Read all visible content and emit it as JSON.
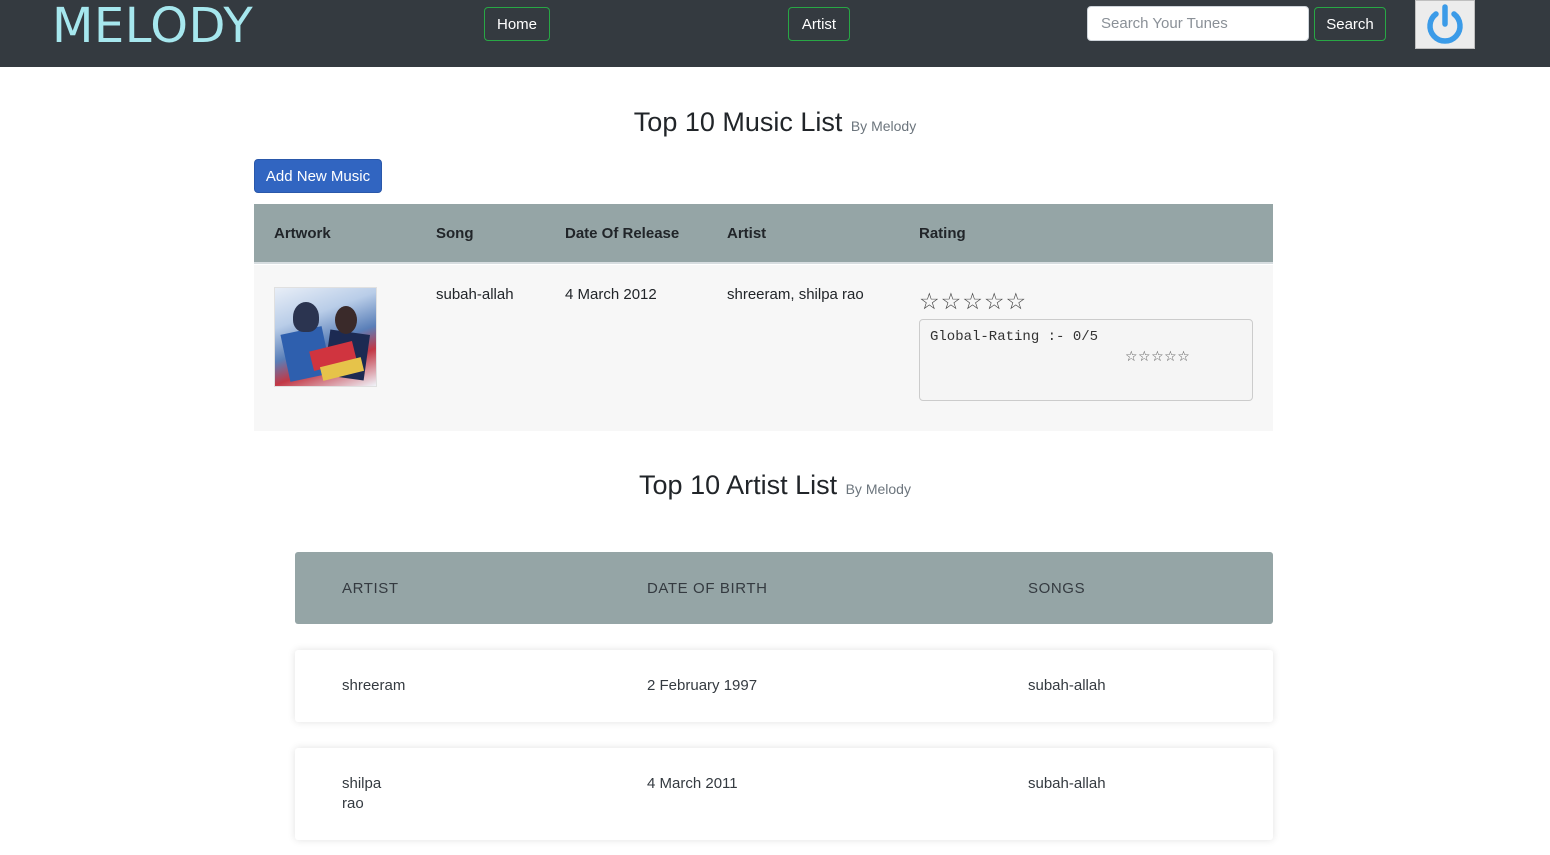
{
  "navbar": {
    "brand": "MELODY",
    "home_label": "Home",
    "artist_label": "Artist",
    "search_placeholder": "Search Your Tunes",
    "search_label": "Search",
    "power_icon": "power-icon",
    "accent_color": "#a6e7ee",
    "button_border_color": "#28a745"
  },
  "music_section": {
    "title": "Top 10 Music List",
    "subtitle": "By Melody",
    "add_button_label": "Add New Music",
    "columns": [
      "Artwork",
      "Song",
      "Date Of Release",
      "Artist",
      "Rating"
    ],
    "rows": [
      {
        "song": "subah-allah",
        "date_of_release": "4 March 2012",
        "artist": "shreeram, shilpa rao",
        "user_rating_stars": "☆☆☆☆☆",
        "user_rating_value": 0,
        "global_rating_label": "Global-Rating :- 0/5",
        "global_rating_stars": "☆☆☆☆☆",
        "global_rating_value": 0
      }
    ]
  },
  "artist_section": {
    "title": "Top 10 Artist List",
    "subtitle": "By Melody",
    "columns": [
      "ARTIST",
      "DATE OF BIRTH",
      "SONGS"
    ],
    "rows": [
      {
        "artist": "shreeram",
        "date_of_birth": "2 February 1997",
        "songs": "subah-allah"
      },
      {
        "artist_line1": "shilpa",
        "artist_line2": "rao",
        "date_of_birth": "4 March 2011",
        "songs": "subah-allah"
      }
    ]
  },
  "colors": {
    "navbar_bg": "#343a40",
    "table_header_bg": "#95a5a6",
    "primary_button": "#3165c1"
  }
}
